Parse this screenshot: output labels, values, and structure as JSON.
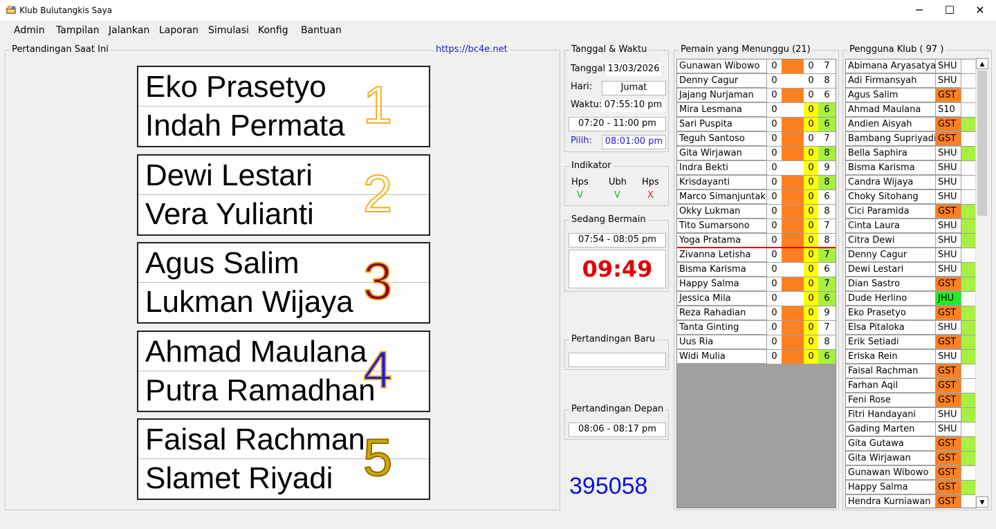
{
  "window": {
    "title": "Klub Bulutangkis Saya",
    "minimize": "─",
    "maximize": "☐",
    "close": "✕"
  },
  "menu": [
    "Admin",
    "Tampilan",
    "Jalankan",
    "Laporan",
    "Simulasi",
    "Konfig",
    "Bantuan"
  ],
  "current_matches": {
    "title": "Pertandingan Saat Ini",
    "link": "https://bc4e.net",
    "courts": [
      {
        "number": "1",
        "player1": "Eko Prasetyo",
        "player2": "Indah Permata",
        "color": "#f4b01c",
        "outline": "#f4b01c",
        "filled": false
      },
      {
        "number": "2",
        "player1": "Dewi Lestari",
        "player2": "Vera Yulianti",
        "color": "#f4b01c",
        "outline": "#f4b01c",
        "filled": false
      },
      {
        "number": "3",
        "player1": "Agus Salim",
        "player2": "Lukman Wijaya",
        "color": "#8b0032",
        "outline": "#f4b01c",
        "filled": true
      },
      {
        "number": "4",
        "player1": "Ahmad Maulana",
        "player2": "Putra Ramadhan",
        "color": "#1a1adc",
        "outline": "#f4b01c",
        "filled": true
      },
      {
        "number": "5",
        "player1": "Faisal Rachman",
        "player2": "Slamet Riyadi",
        "color": "#d4a800",
        "outline": "#8b6b00",
        "filled": true
      }
    ]
  },
  "datetime": {
    "title": "Tanggal & Waktu",
    "date_label": "Tanggal:",
    "date_value": "13/03/2026",
    "day_label": "Hari:",
    "day_value": "Jumat",
    "time_label": "Waktu:",
    "time_value": "07:55:10 pm",
    "session_range": "07:20 - 11:00 pm",
    "pick_label": "Pilih:",
    "pick_value": "08:01:00 pm"
  },
  "indicator": {
    "title": "Indikator",
    "items": [
      {
        "label": "Hps",
        "mark": "V",
        "color": "#2eae2e"
      },
      {
        "label": "Ubh",
        "mark": "V",
        "color": "#2eae2e"
      },
      {
        "label": "Hps",
        "mark": "X",
        "color": "#e02020"
      }
    ]
  },
  "playing": {
    "title": "Sedang Bermain",
    "range": "07:54 - 08:05 pm",
    "timer": "09:49"
  },
  "new_match": {
    "title": "Pertandingan Baru",
    "value": ""
  },
  "next_match": {
    "title": "Pertandingan Depan",
    "range": "08:06 - 08:17 pm"
  },
  "counter": "395058",
  "colors": {
    "orange": "#ff8020",
    "yellow": "#ffff00",
    "green": "#a8f040",
    "bright_green": "#22ee22",
    "red_line": "#e00000",
    "counter_blue": "#1010e0",
    "timer_red": "#e00000",
    "link_blue": "#1a1acc"
  },
  "waiting": {
    "title": "Pemain yang Menunggu (21)",
    "rows": [
      {
        "name": "Gunawan Wibowo",
        "a": "0",
        "b": "",
        "c": "0",
        "d": "7",
        "bcol": "orange",
        "ccol": "white",
        "dcol": "white"
      },
      {
        "name": "Denny Cagur",
        "a": "0",
        "b": "",
        "c": "0",
        "d": "8",
        "bcol": "white",
        "ccol": "white",
        "dcol": "white"
      },
      {
        "name": "Jajang Nurjaman",
        "a": "0",
        "b": "",
        "c": "0",
        "d": "6",
        "bcol": "orange",
        "ccol": "white",
        "dcol": "white"
      },
      {
        "name": "Mira Lesmana",
        "a": "0",
        "b": "",
        "c": "0",
        "d": "6",
        "bcol": "white",
        "ccol": "yellow",
        "dcol": "green"
      },
      {
        "name": "Sari Puspita",
        "a": "0",
        "b": "",
        "c": "0",
        "d": "6",
        "bcol": "orange",
        "ccol": "yellow",
        "dcol": "green"
      },
      {
        "name": "Teguh Santoso",
        "a": "0",
        "b": "",
        "c": "0",
        "d": "7",
        "bcol": "orange",
        "ccol": "white",
        "dcol": "white"
      },
      {
        "name": "Gita Wirjawan",
        "a": "0",
        "b": "",
        "c": "0",
        "d": "8",
        "bcol": "orange",
        "ccol": "yellow",
        "dcol": "green"
      },
      {
        "name": "Indra Bekti",
        "a": "0",
        "b": "",
        "c": "0",
        "d": "9",
        "bcol": "white",
        "ccol": "yellow",
        "dcol": "white"
      },
      {
        "name": "Krisdayanti",
        "a": "0",
        "b": "",
        "c": "0",
        "d": "8",
        "bcol": "orange",
        "ccol": "yellow",
        "dcol": "green"
      },
      {
        "name": "Marco Simanjuntak",
        "a": "0",
        "b": "",
        "c": "0",
        "d": "6",
        "bcol": "orange",
        "ccol": "yellow",
        "dcol": "white"
      },
      {
        "name": "Okky Lukman",
        "a": "0",
        "b": "",
        "c": "0",
        "d": "8",
        "bcol": "orange",
        "ccol": "yellow",
        "dcol": "white"
      },
      {
        "name": "Tito Sumarsono",
        "a": "0",
        "b": "",
        "c": "0",
        "d": "7",
        "bcol": "orange",
        "ccol": "yellow",
        "dcol": "white"
      },
      {
        "name": "Yoga Pratama",
        "a": "0",
        "b": "",
        "c": "0",
        "d": "8",
        "bcol": "orange",
        "ccol": "yellow",
        "dcol": "white"
      },
      {
        "name": "Zivanna Letisha",
        "a": "0",
        "b": "",
        "c": "0",
        "d": "7",
        "bcol": "orange",
        "ccol": "yellow",
        "dcol": "green"
      },
      {
        "name": "Bisma Karisma",
        "a": "0",
        "b": "",
        "c": "0",
        "d": "6",
        "bcol": "white",
        "ccol": "yellow",
        "dcol": "white"
      },
      {
        "name": "Happy Salma",
        "a": "0",
        "b": "",
        "c": "0",
        "d": "7",
        "bcol": "orange",
        "ccol": "yellow",
        "dcol": "green"
      },
      {
        "name": "Jessica Mila",
        "a": "0",
        "b": "",
        "c": "0",
        "d": "6",
        "bcol": "white",
        "ccol": "yellow",
        "dcol": "green"
      },
      {
        "name": "Reza Rahadian",
        "a": "0",
        "b": "",
        "c": "0",
        "d": "9",
        "bcol": "orange",
        "ccol": "yellow",
        "dcol": "white"
      },
      {
        "name": "Tanta Ginting",
        "a": "0",
        "b": "",
        "c": "0",
        "d": "7",
        "bcol": "orange",
        "ccol": "yellow",
        "dcol": "white"
      },
      {
        "name": "Uus Ria",
        "a": "0",
        "b": "",
        "c": "0",
        "d": "8",
        "bcol": "orange",
        "ccol": "yellow",
        "dcol": "white"
      },
      {
        "name": "Widi Mulia",
        "a": "0",
        "b": "",
        "c": "0",
        "d": "6",
        "bcol": "orange",
        "ccol": "yellow",
        "dcol": "green"
      }
    ],
    "divider_after_index": 12
  },
  "members": {
    "title": "Pengguna Klub ( 97 )",
    "scroll_up": "▲",
    "scroll_down": "▼",
    "rows": [
      {
        "name": "Abimana Aryasatya",
        "type": "SHU",
        "tcol": "white",
        "flag": "white"
      },
      {
        "name": "Adi Firmansyah",
        "type": "SHU",
        "tcol": "white",
        "flag": "white"
      },
      {
        "name": "Agus Salim",
        "type": "GST",
        "tcol": "orange",
        "flag": "white"
      },
      {
        "name": "Ahmad Maulana",
        "type": "S10",
        "tcol": "white",
        "flag": "white"
      },
      {
        "name": "Andien Aisyah",
        "type": "GST",
        "tcol": "orange",
        "flag": "green"
      },
      {
        "name": "Bambang Supriyadi",
        "type": "GST",
        "tcol": "orange",
        "flag": "white"
      },
      {
        "name": "Bella Saphira",
        "type": "SHU",
        "tcol": "white",
        "flag": "green"
      },
      {
        "name": "Bisma Karisma",
        "type": "SHU",
        "tcol": "white",
        "flag": "white"
      },
      {
        "name": "Candra Wijaya",
        "type": "SHU",
        "tcol": "white",
        "flag": "white"
      },
      {
        "name": "Choky Sitohang",
        "type": "SHU",
        "tcol": "white",
        "flag": "white"
      },
      {
        "name": "Cici Paramida",
        "type": "GST",
        "tcol": "orange",
        "flag": "green"
      },
      {
        "name": "Cinta Laura",
        "type": "SHU",
        "tcol": "white",
        "flag": "green"
      },
      {
        "name": "Citra Dewi",
        "type": "SHU",
        "tcol": "white",
        "flag": "green"
      },
      {
        "name": "Denny Cagur",
        "type": "SHU",
        "tcol": "white",
        "flag": "white"
      },
      {
        "name": "Dewi Lestari",
        "type": "SHU",
        "tcol": "white",
        "flag": "green"
      },
      {
        "name": "Dian Sastro",
        "type": "GST",
        "tcol": "orange",
        "flag": "green"
      },
      {
        "name": "Dude Herlino",
        "type": "JHU",
        "tcol": "bright_green",
        "flag": "white"
      },
      {
        "name": "Eko Prasetyo",
        "type": "GST",
        "tcol": "orange",
        "flag": "green"
      },
      {
        "name": "Elsa Pitaloka",
        "type": "SHU",
        "tcol": "white",
        "flag": "green"
      },
      {
        "name": "Erik Setiadi",
        "type": "GST",
        "tcol": "orange",
        "flag": "green"
      },
      {
        "name": "Eriska Rein",
        "type": "SHU",
        "tcol": "white",
        "flag": "green"
      },
      {
        "name": "Faisal Rachman",
        "type": "GST",
        "tcol": "orange",
        "flag": "white"
      },
      {
        "name": "Farhan Aqil",
        "type": "GST",
        "tcol": "orange",
        "flag": "white"
      },
      {
        "name": "Feni Rose",
        "type": "GST",
        "tcol": "orange",
        "flag": "green"
      },
      {
        "name": "Fitri Handayani",
        "type": "SHU",
        "tcol": "white",
        "flag": "green"
      },
      {
        "name": "Gading Marten",
        "type": "SHU",
        "tcol": "white",
        "flag": "white"
      },
      {
        "name": "Gita Gutawa",
        "type": "GST",
        "tcol": "orange",
        "flag": "green"
      },
      {
        "name": "Gita Wirjawan",
        "type": "GST",
        "tcol": "orange",
        "flag": "green"
      },
      {
        "name": "Gunawan Wibowo",
        "type": "GST",
        "tcol": "orange",
        "flag": "white"
      },
      {
        "name": "Happy Salma",
        "type": "GST",
        "tcol": "orange",
        "flag": "green"
      },
      {
        "name": "Hendra Kurniawan",
        "type": "GST",
        "tcol": "orange",
        "flag": "white"
      }
    ]
  }
}
